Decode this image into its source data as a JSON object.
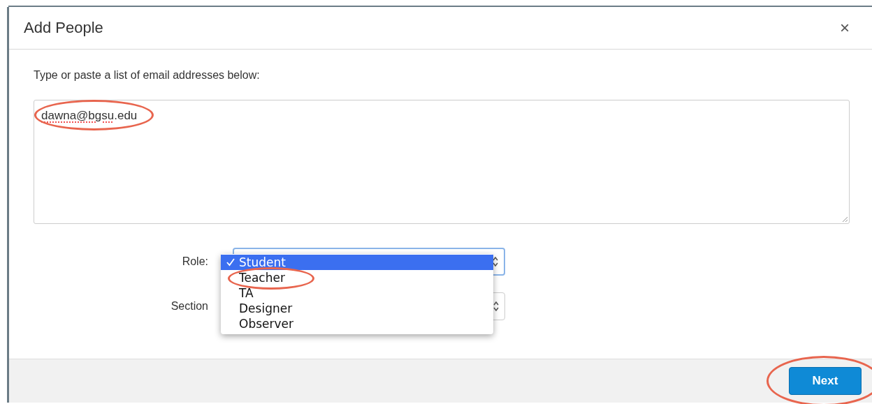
{
  "dialog": {
    "title": "Add People",
    "close": "×"
  },
  "prompt": "Type or paste a list of email addresses below:",
  "email": {
    "value": "dawna@bgsu.edu",
    "misspelled": true,
    "circled": true
  },
  "role": {
    "label": "Role:",
    "expanded": true,
    "options": [
      {
        "label": "Student",
        "selected": true,
        "circled": false
      },
      {
        "label": "Teacher",
        "selected": false,
        "circled": true
      },
      {
        "label": "TA",
        "selected": false,
        "circled": false
      },
      {
        "label": "Designer",
        "selected": false,
        "circled": false
      },
      {
        "label": "Observer",
        "selected": false,
        "circled": false
      }
    ]
  },
  "section": {
    "label": "Section"
  },
  "next": {
    "label": "Next",
    "circled": true
  }
}
